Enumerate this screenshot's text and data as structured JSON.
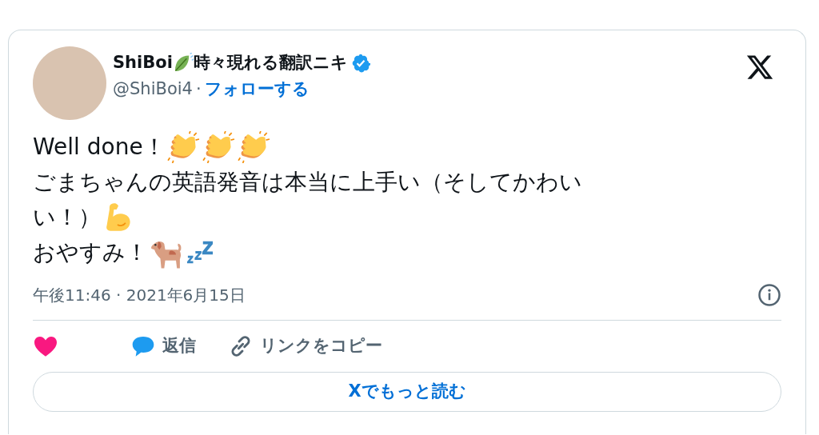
{
  "author": {
    "name_parts": [
      {
        "kind": "text",
        "text": "ShiBoi"
      },
      {
        "kind": "leaf-emoji"
      },
      {
        "kind": "text",
        "text": "時々現れる翻訳ニキ"
      }
    ],
    "verified": true,
    "handle": "@ShiBoi4",
    "separator": "·",
    "follow": "フォローする"
  },
  "body": [
    [
      {
        "kind": "text",
        "text": "Well done！"
      },
      {
        "kind": "clap-emoji"
      },
      {
        "kind": "clap-emoji"
      },
      {
        "kind": "clap-emoji"
      }
    ],
    [
      {
        "kind": "text",
        "text": "ごまちゃんの英語発音は本当に上手い（そしてかわい"
      }
    ],
    [
      {
        "kind": "text",
        "text": "い！）"
      },
      {
        "kind": "muscle-emoji"
      }
    ],
    [
      {
        "kind": "text",
        "text": "おやすみ！"
      },
      {
        "kind": "dog-emoji"
      },
      {
        "kind": "zzz-emoji"
      }
    ]
  ],
  "timestamp": "午後11:46 · 2021年6月15日",
  "actions": [
    {
      "kind": "like"
    },
    {
      "kind": "reply",
      "label": "返信"
    },
    {
      "kind": "copy",
      "label": "リンクをコピー"
    }
  ],
  "read_more": "Xでもっと読む"
}
